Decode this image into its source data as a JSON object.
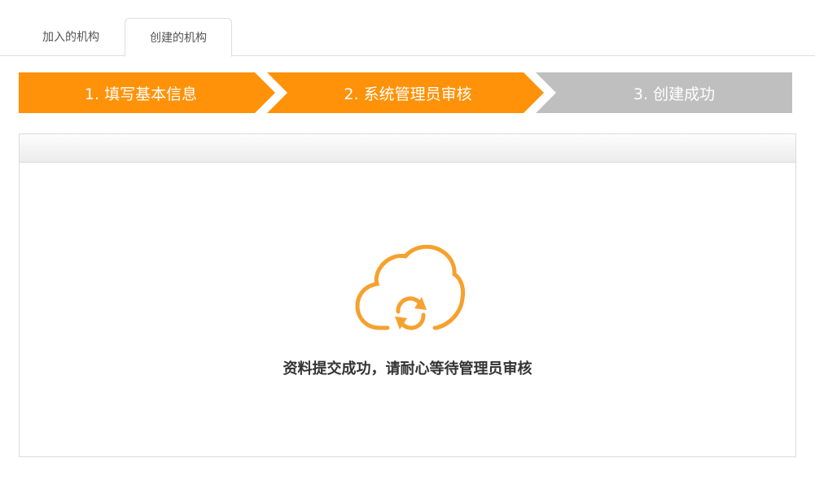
{
  "tabs": [
    {
      "label": "加入的机构",
      "active": false
    },
    {
      "label": "创建的机构",
      "active": true
    }
  ],
  "steps": [
    {
      "label": "1. 填写基本信息",
      "state": "done",
      "color": "#ff9208"
    },
    {
      "label": "2. 系统管理员审核",
      "state": "current",
      "color": "#ff9208"
    },
    {
      "label": "3. 创建成功",
      "state": "pending",
      "color": "#bfbfbf"
    }
  ],
  "status": {
    "icon": "cloud-sync-icon",
    "icon_color": "#f6a12d",
    "message": "资料提交成功，请耐心等待管理员审核"
  }
}
